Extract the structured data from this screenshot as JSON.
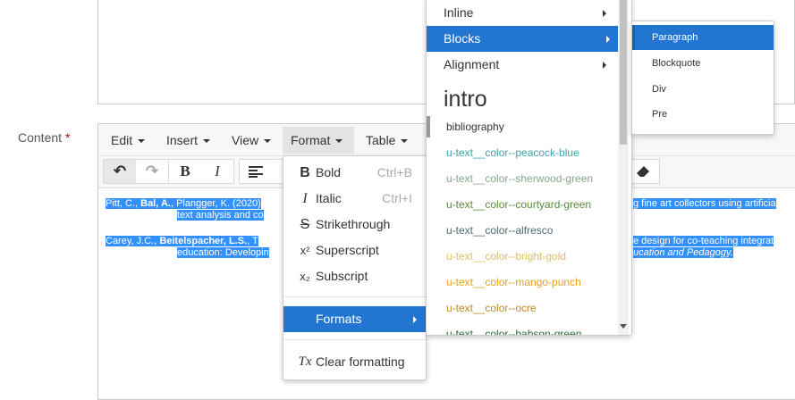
{
  "form": {
    "content_label": "Content",
    "required_mark": "*"
  },
  "menubar": {
    "edit": "Edit",
    "insert": "Insert",
    "view": "View",
    "format": "Format",
    "table": "Table"
  },
  "toolbar": {
    "undo_icon": "↶",
    "redo_icon": "↷",
    "bold_icon": "B",
    "italic_icon": "I"
  },
  "body": {
    "ref1_a": "Pitt, C., ",
    "ref1_b": "Bal, A.",
    "ref1_c": ", Plangger, K. (2020)",
    "ref1_tail": "g fine art collectors using artificia",
    "ref1_line2": "text analysis and co",
    "ref2_a": "Carey, J.C., ",
    "ref2_b": "Beitelspacher, L.S.",
    "ref2_c": ", T",
    "ref2_tail": "e design for co-teaching integrat",
    "ref2_line2": "education: Developin",
    "ref2_line2_tail": "ucation and Pedagogy."
  },
  "format_menu": {
    "items": [
      {
        "icon": "B",
        "label": "Bold",
        "shortcut": "Ctrl+B"
      },
      {
        "icon": "I",
        "label": "Italic",
        "shortcut": "Ctrl+I"
      },
      {
        "icon": "S",
        "label": "Strikethrough",
        "shortcut": ""
      },
      {
        "icon": "x²",
        "label": "Superscript",
        "shortcut": ""
      },
      {
        "icon": "x₂",
        "label": "Subscript",
        "shortcut": ""
      }
    ],
    "formats_label": "Formats",
    "clear_label": "Clear formatting",
    "clear_icon": "Tx"
  },
  "formats_submenu": {
    "items": [
      "Inline",
      "Blocks",
      "Alignment"
    ],
    "styles": [
      {
        "label": "intro",
        "color": "#333333"
      },
      {
        "label": "bibliography",
        "color": "#333333"
      },
      {
        "label": "u-text__color--peacock-blue",
        "color": "#3aa3b0"
      },
      {
        "label": "u-text__color--sherwood-green",
        "color": "#8aa58a"
      },
      {
        "label": "u-text__color--courtyard-green",
        "color": "#5a8a3a"
      },
      {
        "label": "u-text__color--alfresco",
        "color": "#4d6a72"
      },
      {
        "label": "u-text__color--bright-gold",
        "color": "#e0c060"
      },
      {
        "label": "u-text__color--mango-punch",
        "color": "#e8a020"
      },
      {
        "label": "u-text__color--ocre",
        "color": "#c08a20"
      },
      {
        "label": "u-text__color--babson-green",
        "color": "#2e6a3a"
      }
    ]
  },
  "blocks_submenu": {
    "items": [
      "Paragraph",
      "Blockquote",
      "Div",
      "Pre"
    ]
  },
  "colors": {
    "accent": "#2276d2",
    "selection": "#3390ff"
  }
}
